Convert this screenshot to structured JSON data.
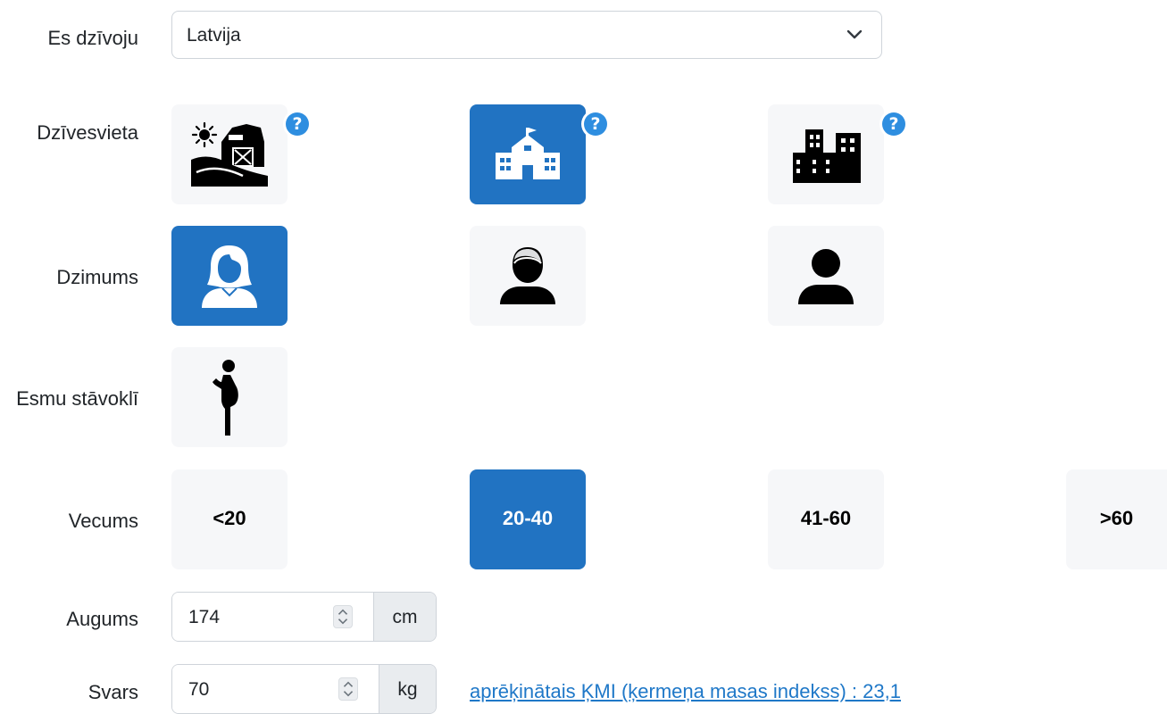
{
  "country": {
    "label": "Es dzīvoju",
    "value": "Latvija"
  },
  "residence": {
    "label": "Dzīvesvieta",
    "options": [
      {
        "icon": "farm-icon",
        "selected": false,
        "help_icon": "question-icon"
      },
      {
        "icon": "school-building-icon",
        "selected": true,
        "help_icon": "question-icon"
      },
      {
        "icon": "city-buildings-icon",
        "selected": false,
        "help_icon": "question-icon"
      }
    ]
  },
  "gender": {
    "label": "Dzimums",
    "options": [
      {
        "icon": "female-user-icon",
        "selected": true
      },
      {
        "icon": "male-user-icon",
        "selected": false
      },
      {
        "icon": "user-icon",
        "selected": false
      }
    ]
  },
  "pregnancy": {
    "label": "Esmu stāvoklī",
    "icon": "pregnant-woman-icon",
    "selected": false
  },
  "age": {
    "label": "Vecums",
    "options": [
      {
        "text": "<20",
        "selected": false
      },
      {
        "text": "20-40",
        "selected": true
      },
      {
        "text": "41-60",
        "selected": false
      },
      {
        "text": ">60",
        "selected": false
      }
    ]
  },
  "height": {
    "label": "Augums",
    "value": "174",
    "unit": "cm"
  },
  "weight": {
    "label": "Svars",
    "value": "70",
    "unit": "kg"
  },
  "bmi_link": "aprēķinātais ĶMI (ķermeņa masas indekss) : 23,1",
  "colors": {
    "accent": "#2173c2",
    "tile": "#f6f7f9",
    "help": "#2e8ee0",
    "link": "#1f78c8"
  }
}
